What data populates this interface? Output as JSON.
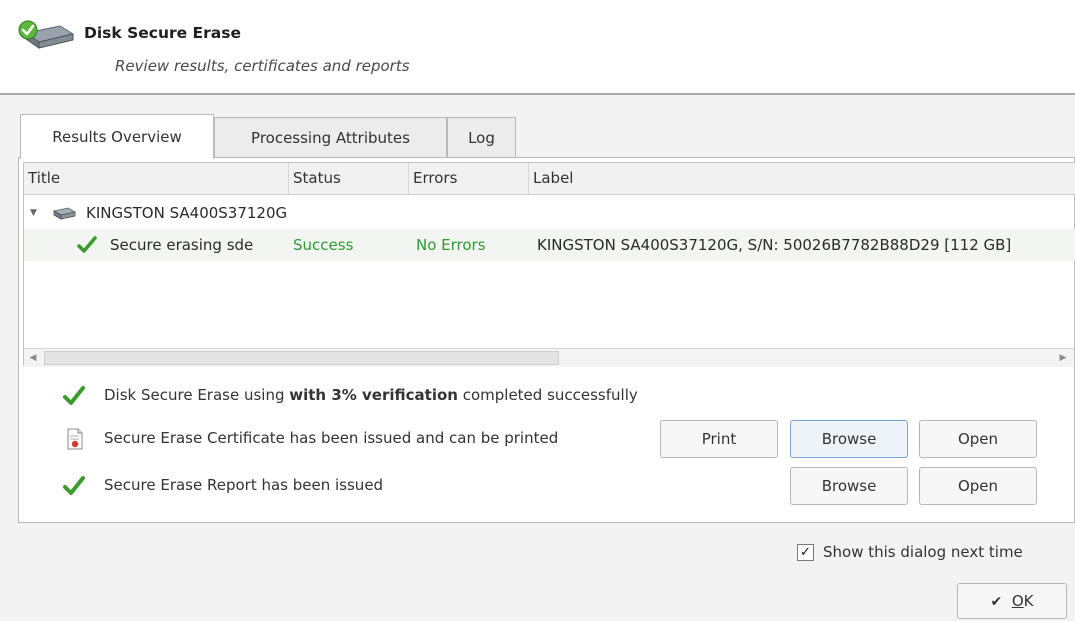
{
  "header": {
    "title": "Disk Secure Erase",
    "subtitle": "Review results, certificates and reports",
    "icon": "disk-check-icon"
  },
  "tabs": [
    {
      "label": "Results Overview",
      "active": true
    },
    {
      "label": "Processing Attributes",
      "active": false
    },
    {
      "label": "Log",
      "active": false
    }
  ],
  "table": {
    "columns": [
      "Title",
      "Status",
      "Errors",
      "Label"
    ],
    "device": {
      "title": "KINGSTON SA400S37120G",
      "expanded": true
    },
    "rows": [
      {
        "title": "Secure erasing sde",
        "status": "Success",
        "errors": "No Errors",
        "label": "KINGSTON SA400S37120G, S/N: 50026B7782B88D29 [112 GB]"
      }
    ]
  },
  "summary": {
    "line1_prefix": "Disk Secure Erase using ",
    "line1_bold": "with 3% verification",
    "line1_suffix": " completed successfully",
    "certificate_text": "Secure Erase Certificate has been issued and can be printed",
    "report_text": "Secure Erase Report has been issued",
    "print_label": "Print",
    "browse_label": "Browse",
    "open_label": "Open"
  },
  "footer": {
    "show_next_time_label": "Show this dialog next time",
    "show_next_time_checked": true,
    "ok_label": "OK",
    "ok_mnemonic": "O",
    "ok_rest": "K"
  },
  "colors": {
    "success": "#2f9a2f",
    "check": "#3a9a2a"
  }
}
